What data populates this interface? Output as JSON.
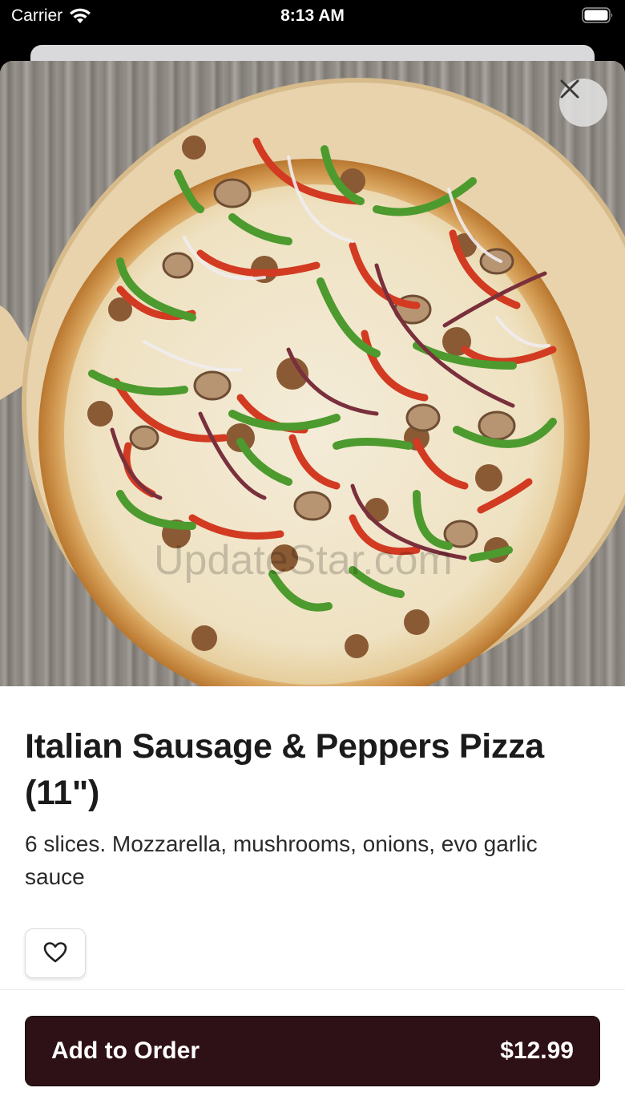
{
  "status_bar": {
    "carrier": "Carrier",
    "time": "8:13 AM",
    "icons": [
      "wifi-icon",
      "battery-icon"
    ]
  },
  "product": {
    "title": "Italian Sausage & Peppers Pizza (11\")",
    "description": "6 slices. Mozzarella, mushrooms, onions, evo garlic sauce",
    "image_watermark": "UpdateStar.com"
  },
  "actions": {
    "close_icon": "close-icon",
    "favorite_icon": "heart-outline-icon",
    "add_label": "Add to Order",
    "price": "$12.99"
  },
  "colors": {
    "primary_button": "#2e1116",
    "text_primary": "#1b1b1b",
    "background": "#ffffff"
  }
}
